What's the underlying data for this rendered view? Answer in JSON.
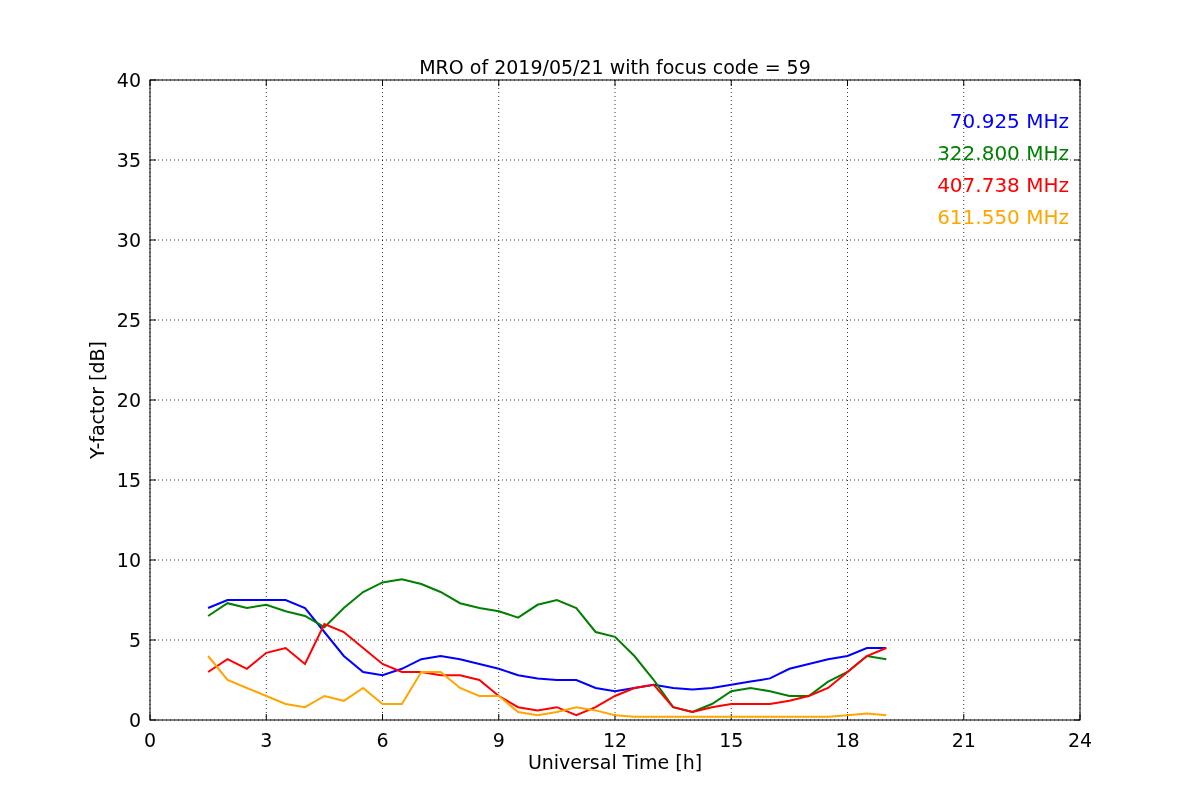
{
  "figure": {
    "chart_data": {
      "type": "line",
      "title": "MRO of 2019/05/21 with focus code = 59",
      "xlabel": "Universal Time [h]",
      "ylabel": "Y-factor [dB]",
      "x": [
        1.5,
        2,
        2.5,
        3,
        3.5,
        4,
        4.5,
        5,
        5.5,
        6,
        6.5,
        7,
        7.5,
        8,
        8.5,
        9,
        9.5,
        10,
        10.5,
        11,
        11.5,
        12,
        12.5,
        13,
        13.5,
        14,
        14.5,
        15,
        15.5,
        16,
        16.5,
        17,
        17.5,
        18,
        18.5,
        19
      ],
      "series": [
        {
          "name": "70.925 MHz",
          "color": "#0000ff",
          "values": [
            7,
            7.5,
            7.5,
            7.5,
            7.5,
            7,
            5.5,
            4,
            3,
            2.8,
            3.2,
            3.8,
            4,
            3.8,
            3.5,
            3.2,
            2.8,
            2.6,
            2.5,
            2.5,
            2,
            1.8,
            2,
            2.2,
            2,
            1.9,
            2,
            2.2,
            2.4,
            2.6,
            3.2,
            3.5,
            3.8,
            4,
            4.5,
            4.5
          ]
        },
        {
          "name": "322.800 MHz",
          "color": "#008000",
          "values": [
            6.5,
            7.3,
            7,
            7.2,
            6.8,
            6.5,
            5.8,
            7,
            8,
            8.6,
            8.8,
            8.5,
            8,
            7.3,
            7,
            6.8,
            6.4,
            7.2,
            7.5,
            7,
            5.5,
            5.2,
            4,
            2.5,
            0.8,
            0.5,
            1,
            1.8,
            2,
            1.8,
            1.5,
            1.5,
            2.4,
            3,
            4,
            3.8
          ]
        },
        {
          "name": "407.738 MHz",
          "color": "#ff0000",
          "values": [
            3,
            3.8,
            3.2,
            4.2,
            4.5,
            3.5,
            6,
            5.5,
            4.5,
            3.5,
            3,
            3,
            2.8,
            2.8,
            2.5,
            1.5,
            0.8,
            0.6,
            0.8,
            0.3,
            0.8,
            1.5,
            2,
            2.2,
            0.8,
            0.5,
            0.8,
            1,
            1,
            1,
            1.2,
            1.5,
            2,
            3,
            4,
            4.5
          ]
        },
        {
          "name": "611.550 MHz",
          "color": "#ffa500",
          "values": [
            4,
            2.5,
            2,
            1.5,
            1,
            0.8,
            1.5,
            1.2,
            2,
            1,
            1,
            3,
            3,
            2,
            1.5,
            1.5,
            0.5,
            0.3,
            0.5,
            0.8,
            0.6,
            0.3,
            0.2,
            0.2,
            0.2,
            0.2,
            0.2,
            0.2,
            0.2,
            0.2,
            0.2,
            0.2,
            0.2,
            0.3,
            0.4,
            0.3
          ]
        }
      ],
      "xlim": [
        0,
        24
      ],
      "ylim": [
        0,
        40
      ],
      "xticks": [
        0,
        3,
        6,
        9,
        12,
        15,
        18,
        21,
        24
      ],
      "yticks": [
        0,
        5,
        10,
        15,
        20,
        25,
        30,
        35,
        40
      ],
      "grid": true
    }
  }
}
